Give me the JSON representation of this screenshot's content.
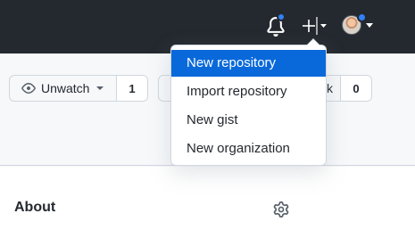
{
  "header": {
    "icons": [
      "bell-icon",
      "plus-icon",
      "chevron-down-icon",
      "avatar"
    ],
    "notification_badge_color": "#2f81f7"
  },
  "repo_actions": {
    "watch_label": "Unwatch",
    "watch_count": "1",
    "partial_label_fragment": "k",
    "second_count": "0"
  },
  "dropdown": {
    "items": [
      {
        "label": "New repository",
        "active": true
      },
      {
        "label": "Import repository",
        "active": false
      },
      {
        "label": "New gist",
        "active": false
      },
      {
        "label": "New organization",
        "active": false
      }
    ],
    "active_color": "#0969da"
  },
  "sidebar": {
    "about_title": "About"
  },
  "colors": {
    "topbar": "#24292f",
    "accent": "#0969da"
  }
}
